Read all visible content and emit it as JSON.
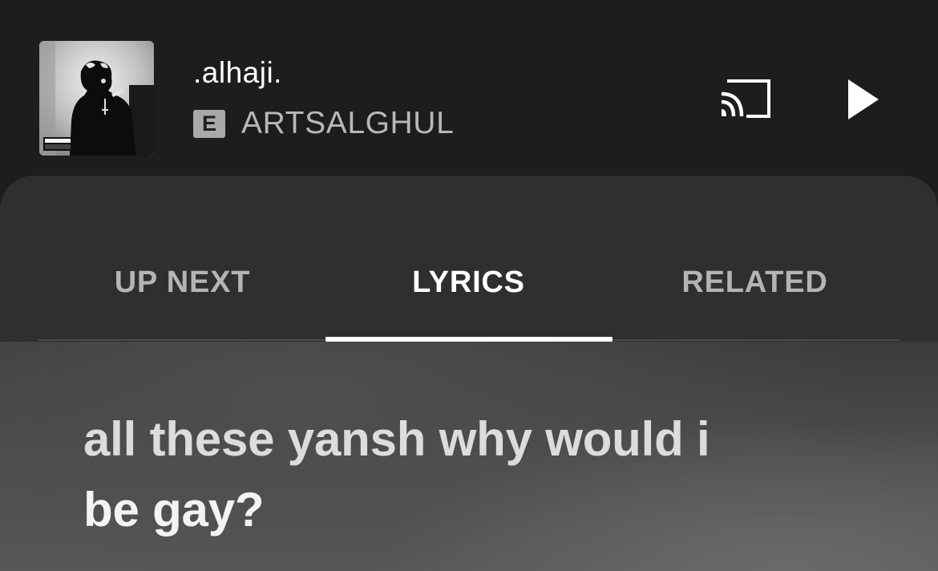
{
  "mini_player": {
    "track_title": ".alhaji.",
    "explicit_badge": "E",
    "artist": "ARTSALGHUL",
    "album_art_icon": "album-cover-image",
    "cast_icon": "cast-icon",
    "play_icon": "play-icon"
  },
  "tabs": [
    {
      "label": "UP NEXT",
      "active": false
    },
    {
      "label": "LYRICS",
      "active": true
    },
    {
      "label": "RELATED",
      "active": false
    }
  ],
  "lyrics": {
    "current_line_1": "all these yansh why would i",
    "current_line_2": "be gay?"
  },
  "colors": {
    "background": "#1d1d1d",
    "sheet": "#2f2f2f",
    "active_tab": "#ffffff",
    "inactive_tab": "#b4b4b4",
    "artist_text": "#b8b8b8"
  }
}
